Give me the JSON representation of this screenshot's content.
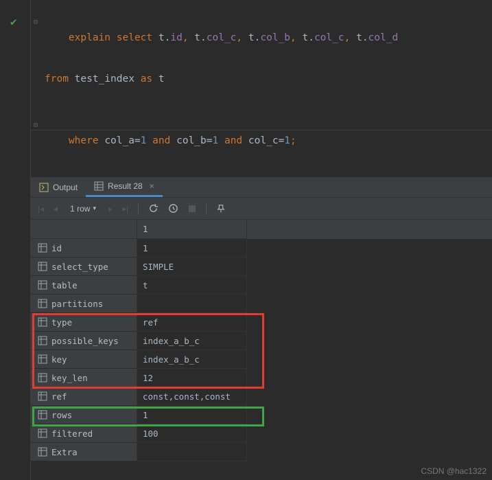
{
  "sql": {
    "line1": {
      "explain": "explain",
      "select": "select",
      "t": "t",
      "id": "id",
      "col_c": "col_c",
      "col_b": "col_b",
      "col_d": "col_d"
    },
    "line2": {
      "from": "from",
      "table": "test_index",
      "as": "as",
      "alias": "t"
    },
    "line3": {
      "where": "where",
      "col_a": "col_a",
      "and1": "and",
      "col_b": "col_b",
      "and2": "and",
      "col_c": "col_c",
      "eq": "=",
      "one": "1"
    }
  },
  "tabs": {
    "output": "Output",
    "result": "Result 28"
  },
  "toolbar": {
    "rows": "1 row"
  },
  "header": {
    "col1": "1"
  },
  "rows": [
    {
      "key": "id",
      "val": "1",
      "null": false
    },
    {
      "key": "select_type",
      "val": "SIMPLE",
      "null": false
    },
    {
      "key": "table",
      "val": "t",
      "null": false
    },
    {
      "key": "partitions",
      "val": "<null>",
      "null": true
    },
    {
      "key": "type",
      "val": "ref",
      "null": false
    },
    {
      "key": "possible_keys",
      "val": "index_a_b_c",
      "null": false
    },
    {
      "key": "key",
      "val": "index_a_b_c",
      "null": false
    },
    {
      "key": "key_len",
      "val": "12",
      "null": false
    },
    {
      "key": "ref",
      "val": "const,const,const",
      "null": false
    },
    {
      "key": "rows",
      "val": "1",
      "null": false
    },
    {
      "key": "filtered",
      "val": "100",
      "null": false
    },
    {
      "key": "Extra",
      "val": "<null>",
      "null": true
    }
  ],
  "watermark": "CSDN @hac1322"
}
